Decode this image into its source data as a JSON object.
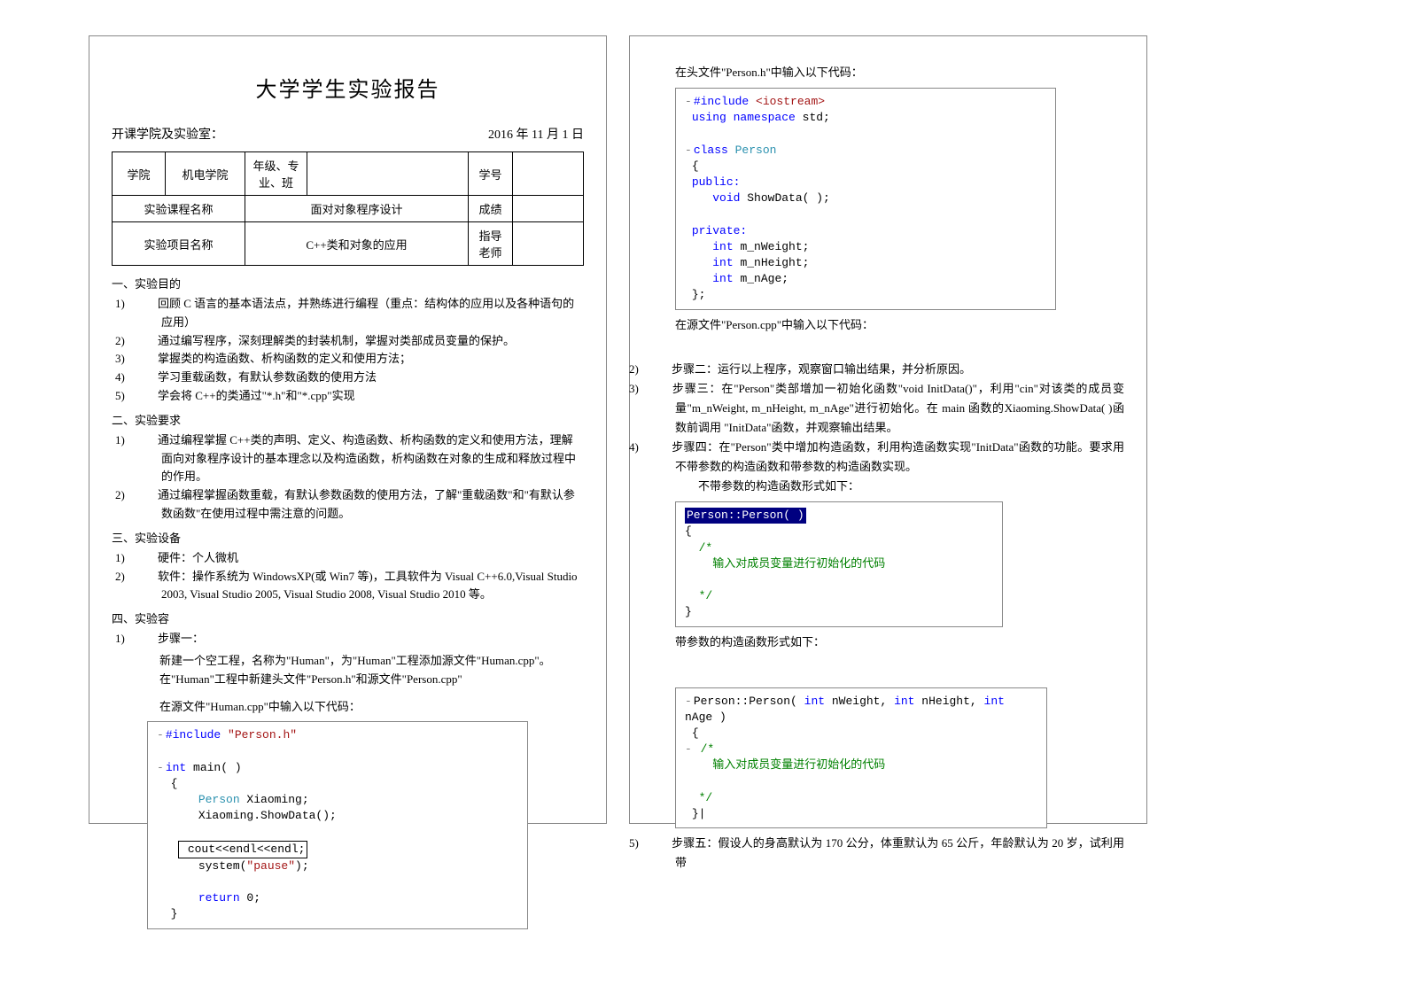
{
  "title": "大学学生实验报告",
  "subhead_left": "开课学院及实验室：",
  "subhead_right": "2016 年 11 月 1 日",
  "table": {
    "r1c1": "学院",
    "r1c2": "机电学院",
    "r1c3": "年级、专业、班",
    "r1c4": "",
    "r1c5": "",
    "r1c6": "学号",
    "r1c7": "",
    "r2c1": "实验课程名称",
    "r2c2": "面对对象程序设计",
    "r2c3": "成绩",
    "r2c4": "",
    "r3c1": "实验项目名称",
    "r3c2": "C++类和对象的应用",
    "r3c3": "指导老师",
    "r3c4": ""
  },
  "sec1": "一、实验目的",
  "s1": {
    "1": "回顾 C 语言的基本语法点，并熟练进行编程（重点：结构体的应用以及各种语句的应用）",
    "2": "通过编写程序，深刻理解类的封装机制，掌握对类部成员变量的保护。",
    "3": "掌握类的构造函数、析构函数的定义和使用方法；",
    "4": "学习重载函数，有默认参数函数的使用方法",
    "5": "学会将 C++的类通过\"*.h\"和\"*.cpp\"实现"
  },
  "sec2": "二、实验要求",
  "s2": {
    "1": "通过编程掌握 C++类的声明、定义、构造函数、析构函数的定义和使用方法，理解面向对象程序设计的基本理念以及构造函数，析构函数在对象的生成和释放过程中的作用。",
    "2": "通过编程掌握函数重载，有默认参数函数的使用方法，了解\"重载函数\"和\"有默认参数函数\"在使用过程中需注意的问题。"
  },
  "sec3": "三、实验设备",
  "s3": {
    "1": "硬件：个人微机",
    "2": "软件：操作系统为 WindowsXP(或 Win7 等)，工具软件为 Visual C++6.0,Visual Studio 2003, Visual Studio 2005, Visual Studio 2008, Visual Studio 2010 等。"
  },
  "sec4": "四、实验容",
  "s4_1": "步骤一：",
  "s4_1a": "新建一个空工程，名称为\"Human\"，为\"Human\"工程添加源文件\"Human.cpp\"。",
  "s4_1b": "在\"Human\"工程中新建头文件\"Person.h\"和源文件\"Person.cpp\"",
  "s4_1c": "在源文件\"Human.cpp\"中输入以下代码：",
  "code1": {
    "l1a": "#include ",
    "l1b": "\"Person.h\"",
    "l2a": "int ",
    "l2b": "main( )",
    "l3": "{",
    "l4a": "Person ",
    "l4b": "Xiaoming;",
    "l5": "Xiaoming.ShowData();",
    "l6": "cout<<endl<<endl;",
    "l6b": "endl;",
    "l7a": "system(",
    "l7b": "\"pause\"",
    "l7c": ");",
    "l8a": "return ",
    "l8b": "0;",
    "l9": "}"
  },
  "r_para1": "在头文件\"Person.h\"中输入以下代码：",
  "code2": {
    "l1a": "#include ",
    "l1b": "<iostream>",
    "l2a": "using namespace ",
    "l2b": "std;",
    "l3a": "class ",
    "l3b": "Person",
    "l4": "{",
    "l5": "public:",
    "l6a": "void ",
    "l6b": "ShowData( );",
    "l7": "private:",
    "l8a": "int ",
    "l8b": "m_nWeight;",
    "l9a": "int ",
    "l9b": "m_nHeight;",
    "l10a": "int ",
    "l10b": "m_nAge;",
    "l11": "};"
  },
  "r_para2": "在源文件\"Person.cpp\"中输入以下代码：",
  "rsteps": {
    "2": "步骤二：运行以上程序，观察窗口输出结果，并分析原因。",
    "3": "步骤三：在\"Person\"类部增加一初始化函数\"void InitData()\"，利用\"cin\"对该类的成员变量\"m_nWeight, m_nHeight, m_nAge\"进行初始化。在 main 函数的Xiaoming.ShowData( )函数前调用 \"InitData\"函数，并观察输出结果。",
    "4": "步骤四：在\"Person\"类中增加构造函数，利用构造函数实现\"InitData\"函数的功能。要求用不带参数的构造函数和带参数的构造函数实现。",
    "4b": "不带参数的构造函数形式如下：",
    "5": "步骤五：假设人的身高默认为 170 公分，体重默认为 65 公斤，年龄默认为 20 岁，试利用带"
  },
  "code3": {
    "l1": "Person::Person( )",
    "l2": "{",
    "l3": "/*",
    "l4": "输入对成员变量进行初始化的代码",
    "l5": "*/",
    "l6": "}"
  },
  "r_para3": "带参数的构造函数形式如下：",
  "code4": {
    "l1a": "Person::Person( ",
    "l1b": "int ",
    "l1c": "nWeight, ",
    "l1d": "int ",
    "l1e": "nHeight, ",
    "l1f": "int ",
    "l1g": "nAge )",
    "l2": "{",
    "l3": "/*",
    "l4": "输入对成员变量进行初始化的代码",
    "l5": "*/",
    "l6": "}|"
  }
}
